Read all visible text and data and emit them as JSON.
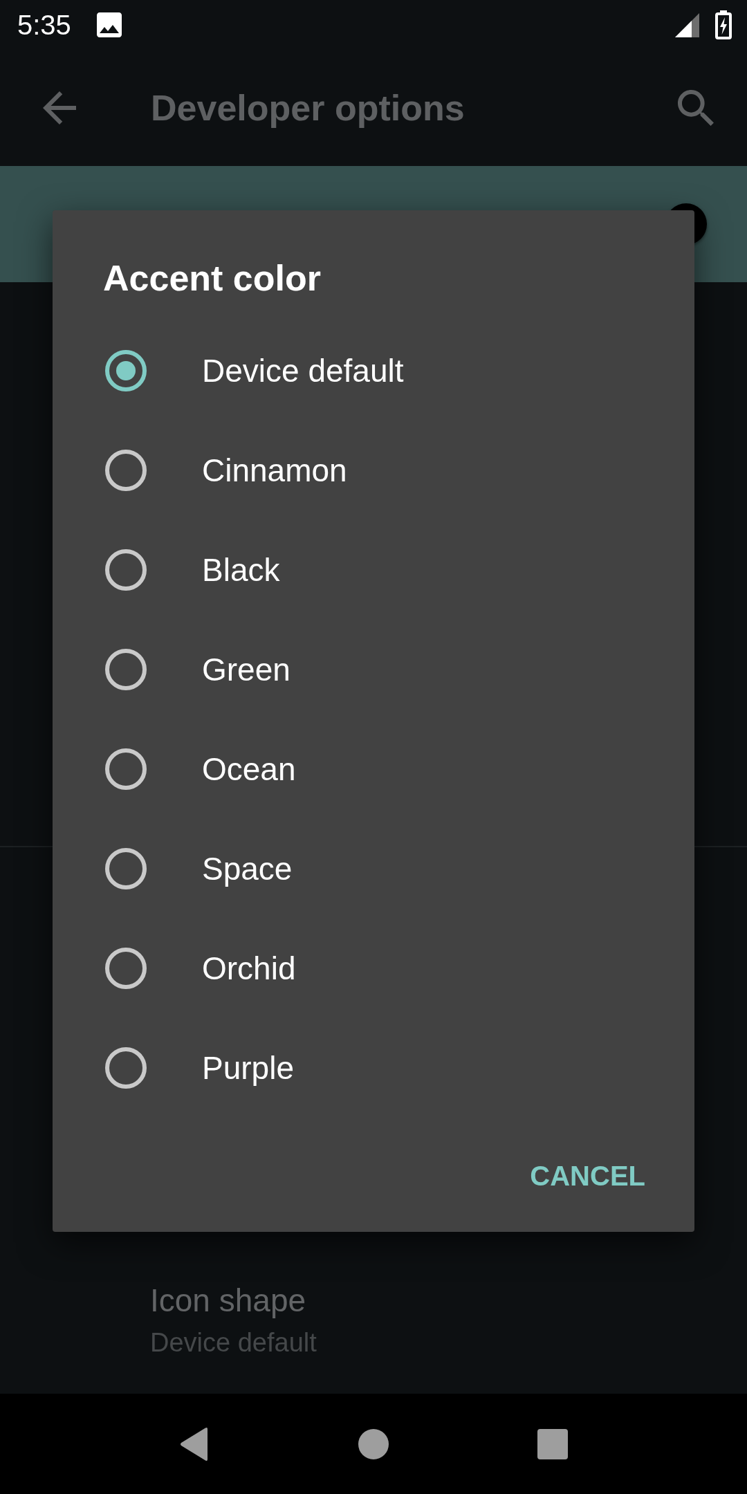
{
  "status_bar": {
    "time": "5:35"
  },
  "app_bar": {
    "title": "Developer options"
  },
  "settings_list": [
    {
      "title": "Icon shape",
      "subtitle": "Device default"
    }
  ],
  "dialog": {
    "title": "Accent color",
    "options": [
      {
        "label": "Device default",
        "selected": true
      },
      {
        "label": "Cinnamon",
        "selected": false
      },
      {
        "label": "Black",
        "selected": false
      },
      {
        "label": "Green",
        "selected": false
      },
      {
        "label": "Ocean",
        "selected": false
      },
      {
        "label": "Space",
        "selected": false
      },
      {
        "label": "Orchid",
        "selected": false
      },
      {
        "label": "Purple",
        "selected": false
      }
    ],
    "buttons": [
      "CANCEL"
    ]
  }
}
